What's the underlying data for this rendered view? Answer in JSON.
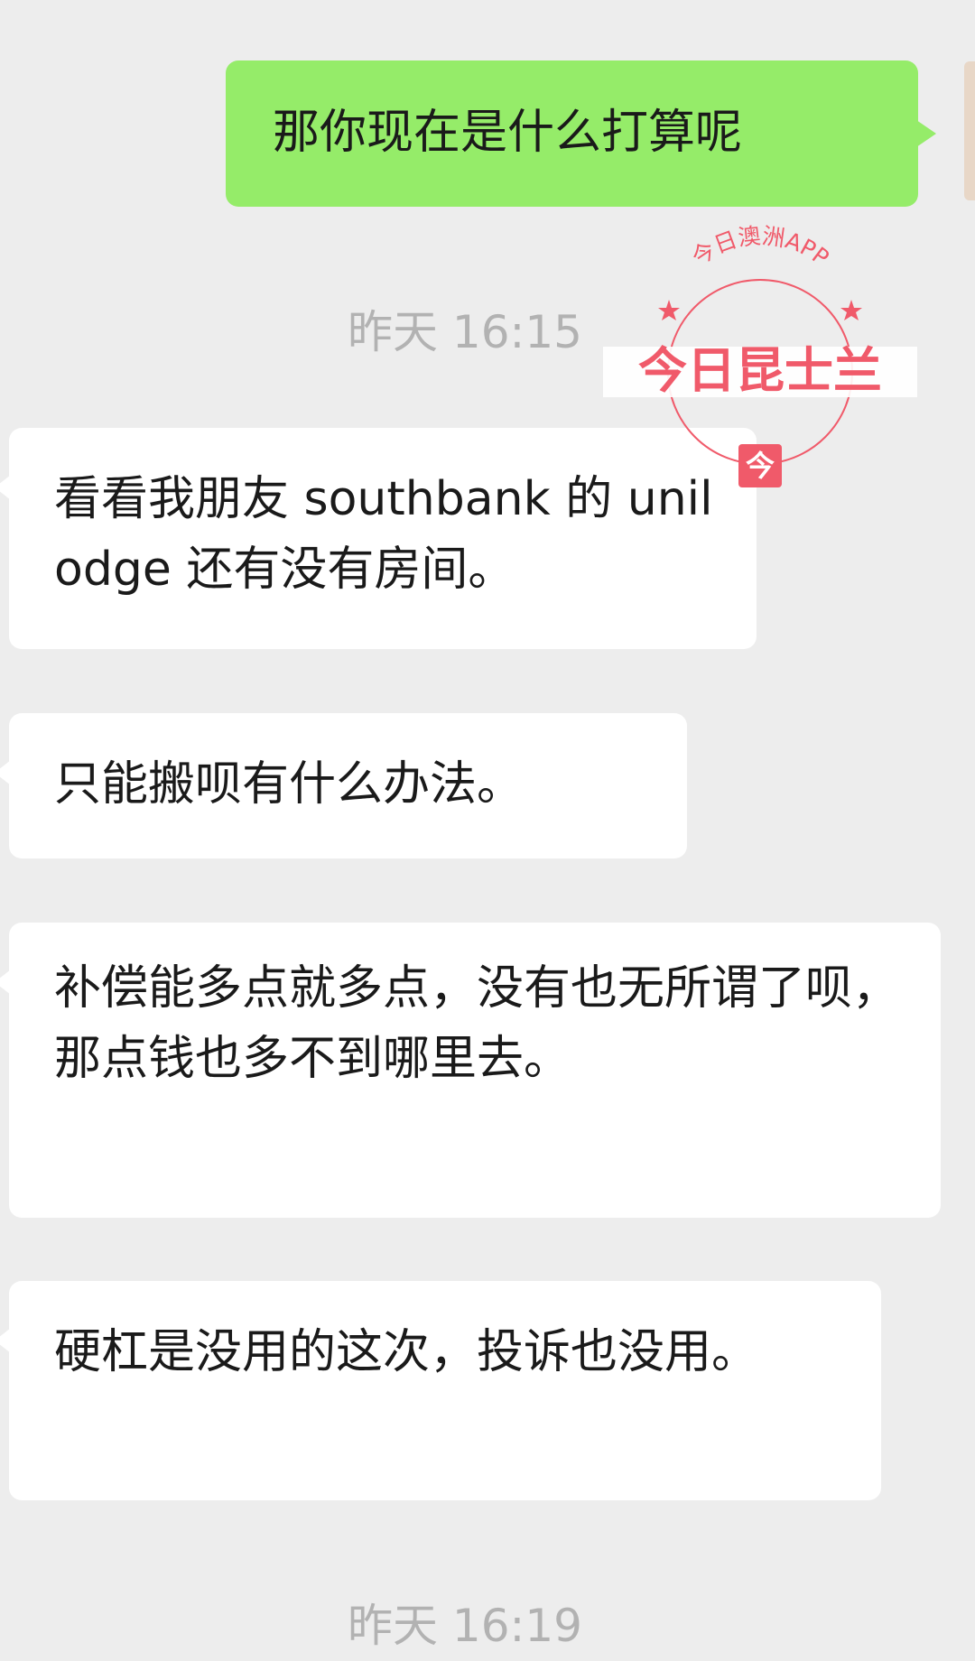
{
  "messages": [
    {
      "side": "outgoing",
      "text": "那你现在是什么打算呢"
    },
    {
      "type": "time",
      "text": "昨天 16:15"
    },
    {
      "side": "incoming",
      "text": "看看我朋友 southbank 的 unilodge 还有没有房间。"
    },
    {
      "side": "incoming",
      "text": "只能搬呗有什么办法。"
    },
    {
      "side": "incoming",
      "text": "补偿能多点就多点，没有也无所谓了呗，那点钱也多不到哪里去。"
    },
    {
      "side": "incoming",
      "text": "硬杠是没用的这次，投诉也没用。"
    },
    {
      "type": "time",
      "text": "昨天 16:19"
    }
  ],
  "watermark": {
    "arc_text": "今日澳洲APP",
    "main_text": "今日昆士兰",
    "badge_text": "今",
    "color": "#f05a6a"
  },
  "colors": {
    "background": "#ededed",
    "outgoing_bubble": "#95ec69",
    "incoming_bubble": "#ffffff",
    "timestamp": "#b2b2b2"
  }
}
